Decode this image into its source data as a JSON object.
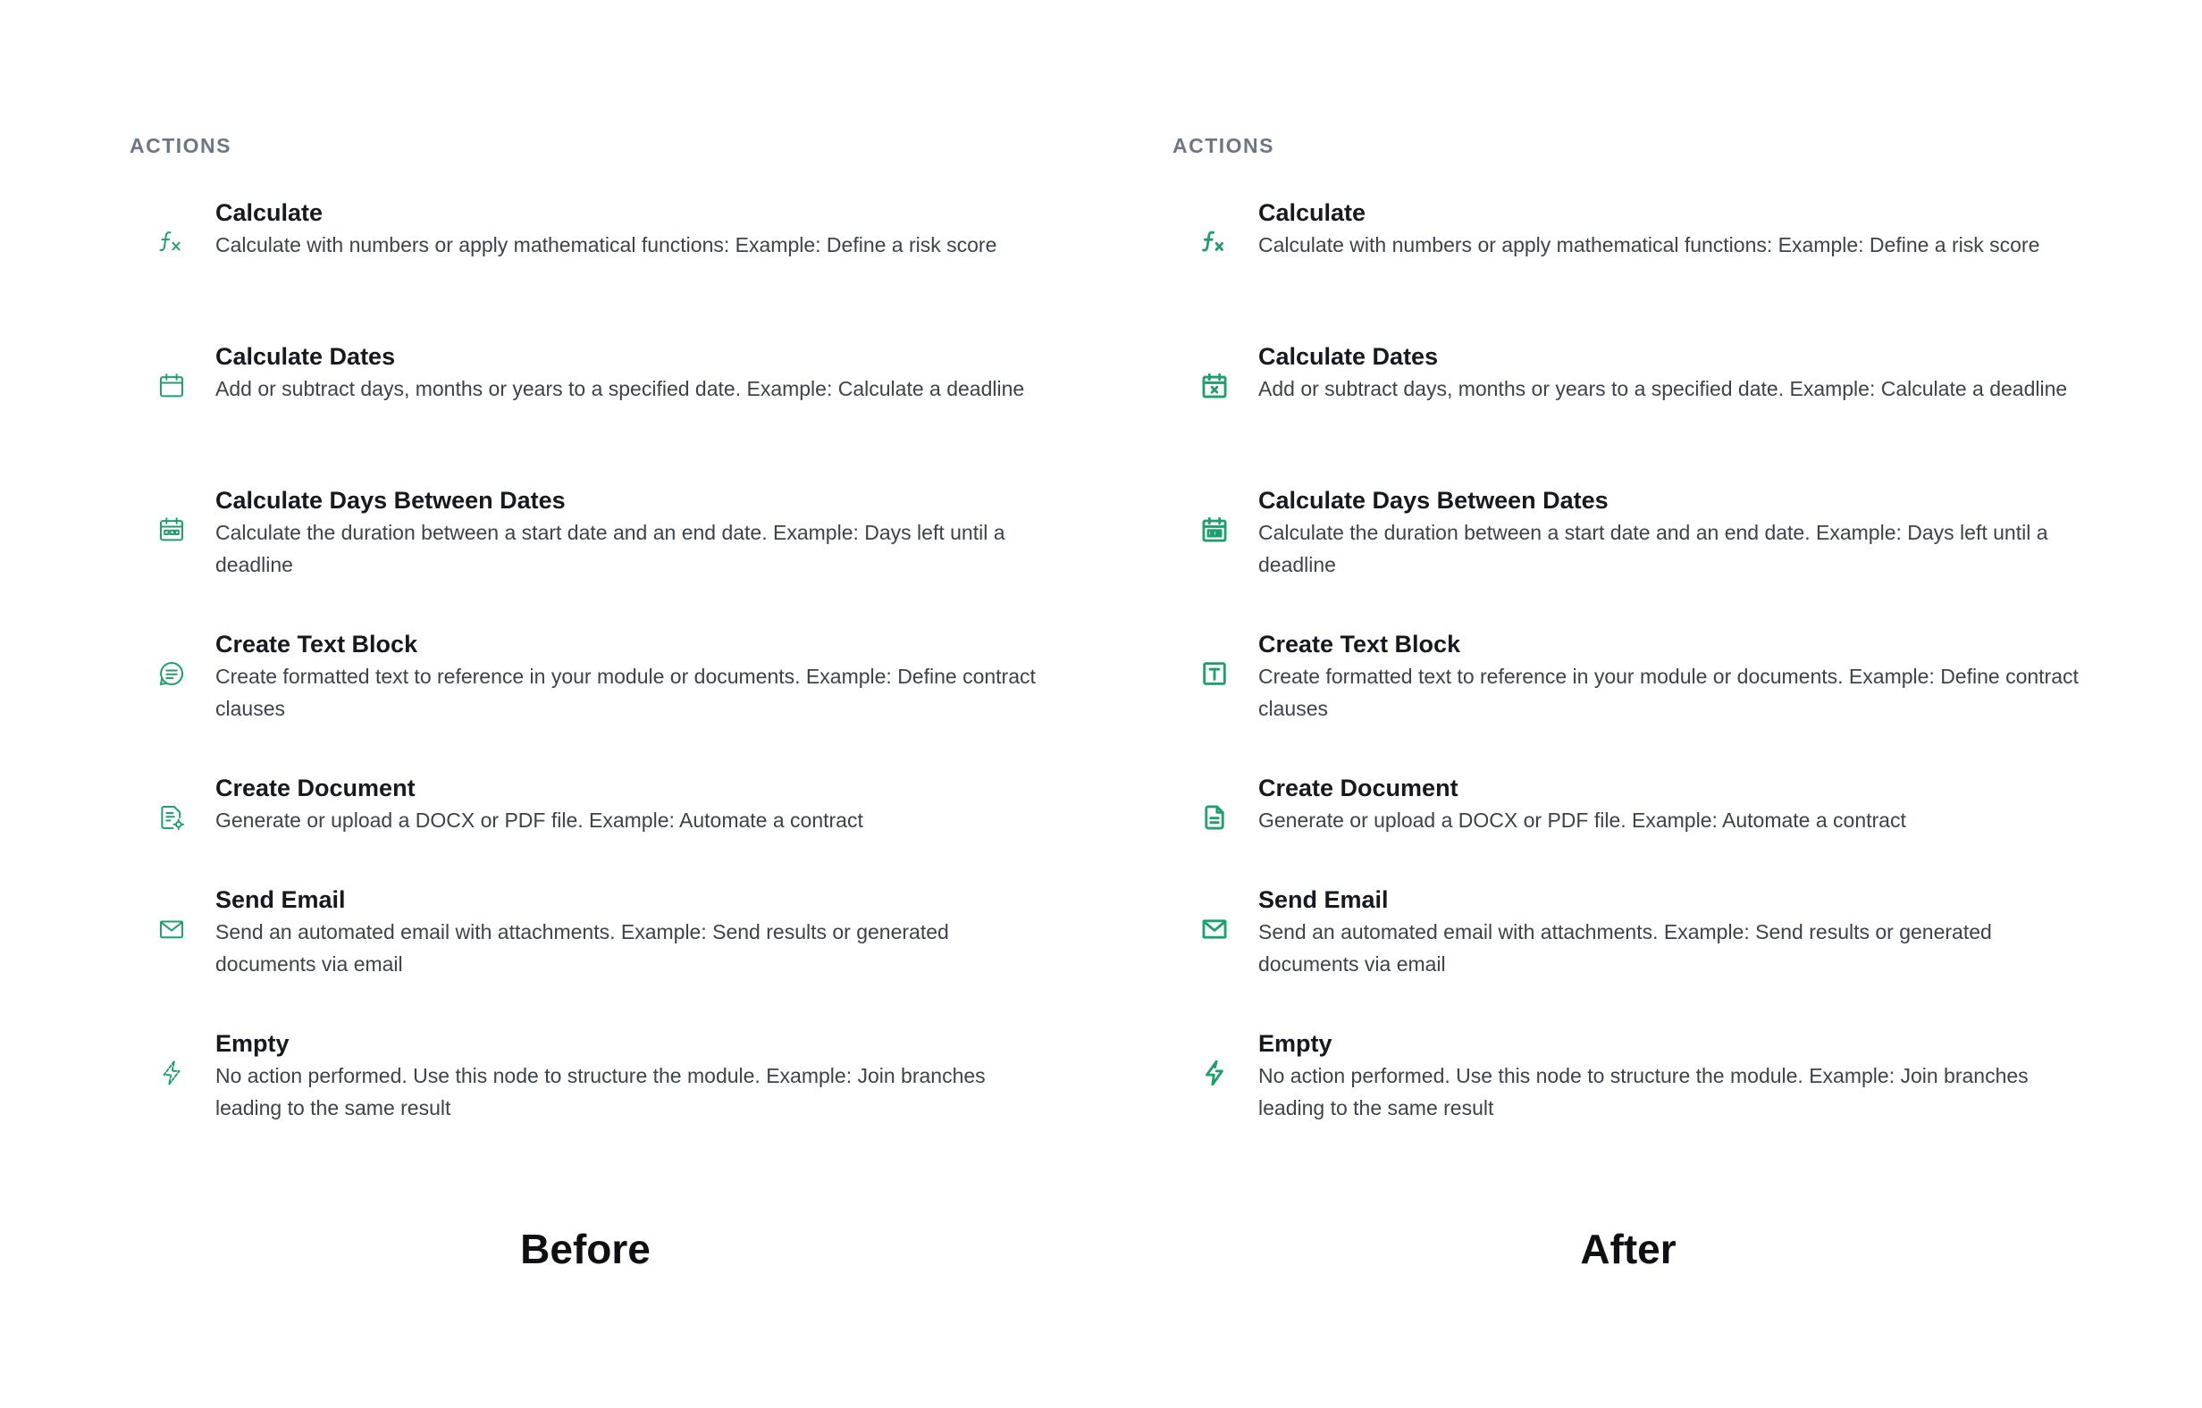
{
  "accent_color": "#1f9e6e",
  "panels": [
    {
      "id": "before",
      "section_title": "ACTIONS",
      "caption": "Before",
      "items": [
        {
          "icon": "function-icon",
          "name": "Calculate",
          "description": "Calculate with numbers or apply mathematical functions: Example: Define a risk score"
        },
        {
          "icon": "calendar-icon",
          "name": "Calculate Dates",
          "description": "Add or subtract days, months or years to a specified date. Example: Calculate a deadline"
        },
        {
          "icon": "calendar-grid-icon",
          "name": "Calculate Days Between Dates",
          "description": "Calculate the duration between a start date and an end date. Example: Days left until a deadline"
        },
        {
          "icon": "text-bubble-icon",
          "name": "Create Text Block",
          "description": "Create formatted text to reference in your module or documents. Example: Define contract clauses"
        },
        {
          "icon": "document-gear-icon",
          "name": "Create Document",
          "description": "Generate or upload a DOCX or PDF file. Example: Automate a contract"
        },
        {
          "icon": "envelope-icon",
          "name": "Send Email",
          "description": "Send an automated email with attachments. Example: Send results or generated documents via email"
        },
        {
          "icon": "lightning-off-icon",
          "name": "Empty",
          "description": "No action performed. Use this node to structure the module. Example: Join branches leading to the same result"
        }
      ]
    },
    {
      "id": "after",
      "section_title": "ACTIONS",
      "caption": "After",
      "items": [
        {
          "icon": "function-icon",
          "name": "Calculate",
          "description": "Calculate with numbers or apply mathematical functions: Example: Define a risk score"
        },
        {
          "icon": "calendar-x-icon",
          "name": "Calculate Dates",
          "description": "Add or subtract days, months or years to a specified date. Example: Calculate a deadline"
        },
        {
          "icon": "calendar-grid-icon",
          "name": "Calculate Days Between Dates",
          "description": "Calculate the duration between a start date and an end date. Example: Days left until a deadline"
        },
        {
          "icon": "text-t-icon",
          "name": "Create Text Block",
          "description": "Create formatted text to reference in your module or documents. Example: Define contract clauses"
        },
        {
          "icon": "document-icon",
          "name": "Create Document",
          "description": "Generate or upload a DOCX or PDF file. Example: Automate a contract"
        },
        {
          "icon": "envelope-icon",
          "name": "Send Email",
          "description": "Send an automated email with attachments. Example: Send results or generated documents via email"
        },
        {
          "icon": "lightning-off-icon",
          "name": "Empty",
          "description": "No action performed. Use this node to structure the module. Example: Join branches leading to the same result"
        }
      ]
    }
  ]
}
